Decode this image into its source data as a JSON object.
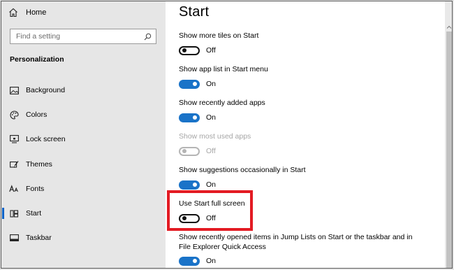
{
  "sidebar": {
    "home_label": "Home",
    "search_placeholder": "Find a setting",
    "section_title": "Personalization",
    "items": [
      {
        "label": "Background",
        "icon": "image-icon"
      },
      {
        "label": "Colors",
        "icon": "palette-icon"
      },
      {
        "label": "Lock screen",
        "icon": "lock-screen-icon"
      },
      {
        "label": "Themes",
        "icon": "brush-icon"
      },
      {
        "label": "Fonts",
        "icon": "font-icon"
      },
      {
        "label": "Start",
        "icon": "start-icon",
        "active": true
      },
      {
        "label": "Taskbar",
        "icon": "taskbar-icon"
      }
    ]
  },
  "main": {
    "title": "Start",
    "settings": [
      {
        "label": "Show more tiles on Start",
        "state": "Off",
        "on": false,
        "enabled": true
      },
      {
        "label": "Show app list in Start menu",
        "state": "On",
        "on": true,
        "enabled": true
      },
      {
        "label": "Show recently added apps",
        "state": "On",
        "on": true,
        "enabled": true
      },
      {
        "label": "Show most used apps",
        "state": "Off",
        "on": false,
        "enabled": false
      },
      {
        "label": "Show suggestions occasionally in Start",
        "state": "On",
        "on": true,
        "enabled": true
      },
      {
        "label": "Use Start full screen",
        "state": "Off",
        "on": false,
        "enabled": true,
        "highlighted": true
      },
      {
        "label": "Show recently opened items in Jump Lists on Start or the taskbar and in File Explorer Quick Access",
        "state": "On",
        "on": true,
        "enabled": true
      }
    ]
  },
  "colors": {
    "accent": "#1a73c8",
    "highlight": "#e31b23",
    "sidebar_bg": "#e6e6e6",
    "disabled_text": "#a6a6a6"
  }
}
